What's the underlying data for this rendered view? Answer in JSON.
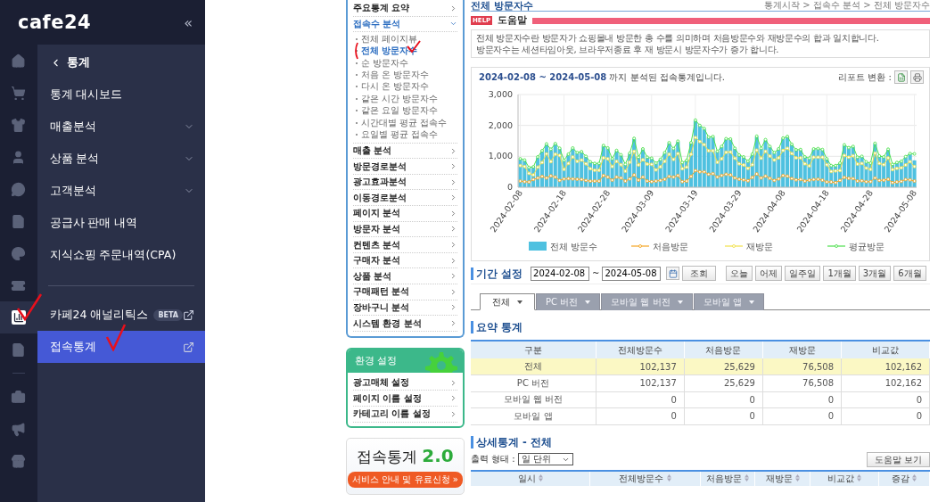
{
  "sidebar": {
    "logo": "cafe24",
    "collapse": "«",
    "rail": [
      {
        "selected": false
      },
      {
        "selected": false
      },
      {
        "selected": false
      },
      {
        "selected": false
      },
      {
        "selected": false
      },
      {
        "selected": false
      },
      {
        "selected": false
      },
      {
        "selected": false
      },
      {
        "selected": true
      },
      {
        "selected": false
      },
      {
        "selected": false
      },
      {
        "selected": false
      },
      {
        "selected": false
      }
    ],
    "menu_title": "통계",
    "items": [
      {
        "label": "통계 대시보드",
        "kind": "link",
        "selected": false
      },
      {
        "label": "매출분석",
        "kind": "group",
        "selected": false
      },
      {
        "label": "상품 분석",
        "kind": "group",
        "selected": false
      },
      {
        "label": "고객분석",
        "kind": "group",
        "selected": false
      },
      {
        "label": "공급사 판매 내역",
        "kind": "link",
        "selected": false
      },
      {
        "label": "지식쇼핑 주문내역(CPA)",
        "kind": "link",
        "selected": false
      }
    ],
    "external_items": [
      {
        "label": "카페24 애널리틱스",
        "badge": "BETA",
        "selected": false
      },
      {
        "label": "접속통계",
        "selected": true
      }
    ]
  },
  "stats_menu": {
    "items": [
      {
        "label": "주요통계 요약",
        "expanded": false
      },
      {
        "label": "접속수 분석",
        "expanded": true,
        "children": [
          {
            "label": "전체 페이지뷰",
            "selected": false
          },
          {
            "label": "전체 방문자수",
            "selected": true
          },
          {
            "label": "순 방문자수",
            "selected": false
          },
          {
            "label": "처음 온 방문자수",
            "selected": false
          },
          {
            "label": "다시 온 방문자수",
            "selected": false
          },
          {
            "label": "같은 시간 방문자수",
            "selected": false
          },
          {
            "label": "같은 요일 방문자수",
            "selected": false
          },
          {
            "label": "시간대별 평균 접속수",
            "selected": false
          },
          {
            "label": "요일별 평균 접속수",
            "selected": false
          }
        ]
      },
      {
        "label": "매출 분석",
        "expanded": false
      },
      {
        "label": "방문경로분석",
        "expanded": false
      },
      {
        "label": "광고효과분석",
        "expanded": false
      },
      {
        "label": "이동경로분석",
        "expanded": false
      },
      {
        "label": "페이지 분석",
        "expanded": false
      },
      {
        "label": "방문자 분석",
        "expanded": false
      },
      {
        "label": "컨텐츠 분석",
        "expanded": false
      },
      {
        "label": "구매자 분석",
        "expanded": false
      },
      {
        "label": "상품 분석",
        "expanded": false
      },
      {
        "label": "구매패턴 분석",
        "expanded": false
      },
      {
        "label": "장바구니 분석",
        "expanded": false
      },
      {
        "label": "시스템 환경 분석",
        "expanded": false
      }
    ]
  },
  "settings": {
    "title": "환경 설정",
    "items": [
      "광고매체 설정",
      "페이지 이름 설정",
      "카테고리 이름 설정"
    ]
  },
  "banner": {
    "title": "접속통계",
    "version": "2.0",
    "button": "서비스 안내 및 유료신청 »"
  },
  "page": {
    "title": "전체 방문자수",
    "breadcrumb": "통계시작 > 접속수 분석 > 전체 방문자수"
  },
  "help": {
    "badge": "HELP",
    "title": "도움말",
    "lines": [
      "전체 방문자수란 방문자가 쇼핑몰내 방문한 총 수를 의미하며 처음방문수와 재방문수의 합과 일치합니다.",
      "방문자수는 세션타임아웃, 브라우저종료 후 재 방문시 방문자수가 증가 합니다."
    ]
  },
  "chart": {
    "caption": "**2024-02-08 ~ 2024-05-08** 까지 분석된 접속통계입니다.",
    "report_label": "리포트 변환 :",
    "chart_data": {
      "type": "bar",
      "ylim": [
        0,
        3000
      ],
      "yticks": [
        {
          "value": 0,
          "label": "0"
        },
        {
          "value": 1000,
          "label": "1,000"
        },
        {
          "value": 2000,
          "label": "2,000"
        },
        {
          "value": 3000,
          "label": "3,000"
        }
      ],
      "grid": true,
      "legend": true,
      "categories": [
        "2024-02-08",
        null,
        null,
        null,
        null,
        null,
        null,
        null,
        null,
        null,
        "2024-02-18",
        null,
        null,
        null,
        null,
        null,
        null,
        null,
        null,
        null,
        "2024-02-28",
        null,
        null,
        null,
        null,
        null,
        null,
        null,
        null,
        null,
        "2024-03-09",
        null,
        null,
        null,
        null,
        null,
        null,
        null,
        null,
        null,
        "2024-03-19",
        null,
        null,
        null,
        null,
        null,
        null,
        null,
        null,
        null,
        "2024-03-29",
        null,
        null,
        null,
        null,
        null,
        null,
        null,
        null,
        null,
        "2024-04-08",
        null,
        null,
        null,
        null,
        null,
        null,
        null,
        null,
        null,
        "2024-04-18",
        null,
        null,
        null,
        null,
        null,
        null,
        null,
        null,
        null,
        "2024-04-28",
        null,
        null,
        null,
        null,
        null,
        null,
        null,
        null,
        null,
        "2024-05-08"
      ],
      "series": [
        {
          "name": "전체 방문수",
          "type": "bar",
          "color": "#4fc1e0",
          "values": [
            900,
            850,
            620,
            650,
            950,
            1150,
            1380,
            1200,
            1400,
            1250,
            850,
            1050,
            1250,
            1100,
            1130,
            980,
            800,
            750,
            750,
            1330,
            1250,
            900,
            1170,
            1030,
            720,
            1080,
            1560,
            950,
            1220,
            950,
            920,
            760,
            880,
            1100,
            1420,
            1230,
            1470,
            780,
            850,
            1420,
            2150,
            1980,
            1880,
            1600,
            1620,
            1140,
            1300,
            1550,
            1540,
            1240,
            1020,
            960,
            820,
            1050,
            1630,
            1240,
            1520,
            1300,
            1100,
            1220,
            1570,
            1620,
            1370,
            1190,
            1200,
            960,
            920,
            1220,
            1230,
            1200,
            900,
            680,
            680,
            760,
            1350,
            1260,
            1300,
            950,
            980,
            800,
            760,
            1400,
            990,
            960,
            1210,
            720,
            780,
            820,
            970,
            1070,
            870
          ]
        },
        {
          "name": "처음방문",
          "type": "line",
          "marker": "circle",
          "color": "#f5a623",
          "values": [
            200,
            180,
            170,
            250,
            300,
            350,
            300,
            370,
            330,
            220,
            270,
            280,
            270,
            260,
            250,
            220,
            200,
            200,
            200,
            380,
            330,
            230,
            330,
            300,
            200,
            270,
            400,
            230,
            330,
            200,
            180,
            200,
            220,
            260,
            350,
            330,
            380,
            180,
            200,
            350,
            540,
            500,
            500,
            420,
            440,
            330,
            380,
            420,
            400,
            300,
            260,
            240,
            210,
            320,
            430,
            300,
            360,
            290,
            220,
            270,
            380,
            360,
            280,
            240,
            250,
            200,
            230,
            250,
            260,
            230,
            170,
            170,
            150,
            220,
            320,
            290,
            280,
            200,
            210,
            180,
            180,
            300,
            220,
            230,
            260,
            150,
            170,
            190,
            250,
            240,
            200
          ]
        },
        {
          "name": "재방문",
          "type": "line",
          "marker": "circle",
          "color": "#f2e24a",
          "values": [
            700,
            670,
            450,
            400,
            650,
            800,
            1080,
            830,
            1070,
            1030,
            580,
            770,
            980,
            840,
            880,
            760,
            600,
            550,
            550,
            950,
            920,
            670,
            840,
            730,
            520,
            810,
            1160,
            720,
            890,
            750,
            740,
            560,
            660,
            840,
            1070,
            900,
            1090,
            600,
            650,
            1070,
            1610,
            1480,
            1380,
            1180,
            1180,
            810,
            920,
            1130,
            1140,
            940,
            760,
            720,
            610,
            730,
            1200,
            940,
            1160,
            1010,
            880,
            950,
            1190,
            1260,
            1090,
            950,
            950,
            760,
            690,
            970,
            970,
            970,
            730,
            510,
            530,
            540,
            1030,
            970,
            1020,
            750,
            770,
            620,
            580,
            1100,
            770,
            730,
            950,
            570,
            610,
            630,
            720,
            830,
            670
          ]
        },
        {
          "name": "평균방문",
          "type": "line",
          "marker": "circle",
          "color": "#4de04d",
          "values": [
            920,
            880,
            640,
            660,
            980,
            1180,
            1400,
            1230,
            1410,
            1260,
            870,
            1070,
            1270,
            1120,
            1150,
            1000,
            820,
            770,
            770,
            1350,
            1270,
            920,
            1190,
            1050,
            740,
            1100,
            1580,
            970,
            1240,
            970,
            940,
            780,
            900,
            1120,
            1440,
            1250,
            1490,
            800,
            870,
            1440,
            2170,
            2000,
            1900,
            1620,
            1640,
            1160,
            1320,
            1570,
            1560,
            1260,
            1040,
            980,
            840,
            1070,
            1650,
            1260,
            1540,
            1320,
            1120,
            1240,
            1590,
            1640,
            1390,
            1210,
            1220,
            980,
            940,
            1240,
            1250,
            1220,
            920,
            700,
            700,
            780,
            1370,
            1280,
            1320,
            970,
            1000,
            820,
            780,
            1420,
            1010,
            980,
            1230,
            740,
            800,
            840,
            990,
            1090,
            1080
          ]
        }
      ]
    }
  },
  "period": {
    "label": "기간 설정",
    "start": "2024-02-08",
    "separator": "~",
    "end": "2024-05-08",
    "search": "조회",
    "presets": [
      "오늘",
      "어제",
      "일주일",
      "1개월",
      "3개월",
      "6개월"
    ]
  },
  "tabs": [
    {
      "label": "전체",
      "selected": true
    },
    {
      "label": "PC 버전",
      "selected": false
    },
    {
      "label": "모바일 웹 버전",
      "selected": false
    },
    {
      "label": "모바일 앱",
      "selected": false
    }
  ],
  "summary": {
    "title": "요약 통계",
    "columns": [
      "구분",
      "전체방문수",
      "처음방문",
      "재방문",
      "비교값"
    ],
    "rows": [
      {
        "selected": true,
        "cells": [
          "전체",
          "102,137",
          "25,629",
          "76,508",
          "102,162"
        ]
      },
      {
        "selected": false,
        "cells": [
          "PC 버전",
          "102,137",
          "25,629",
          "76,508",
          "102,162"
        ]
      },
      {
        "selected": false,
        "cells": [
          "모바일 웹 버전",
          "0",
          "0",
          "0",
          "0"
        ]
      },
      {
        "selected": false,
        "cells": [
          "모바일 앱",
          "0",
          "0",
          "0",
          "0"
        ]
      }
    ]
  },
  "detail": {
    "title": "상세통계 - 전체",
    "output_label": "출력 형태 :",
    "output_value": "일 단위",
    "help_button": "도움말 보기",
    "columns": [
      "일시",
      "전체방문수",
      "처음방문",
      "재방문",
      "비교값",
      "증감"
    ]
  }
}
